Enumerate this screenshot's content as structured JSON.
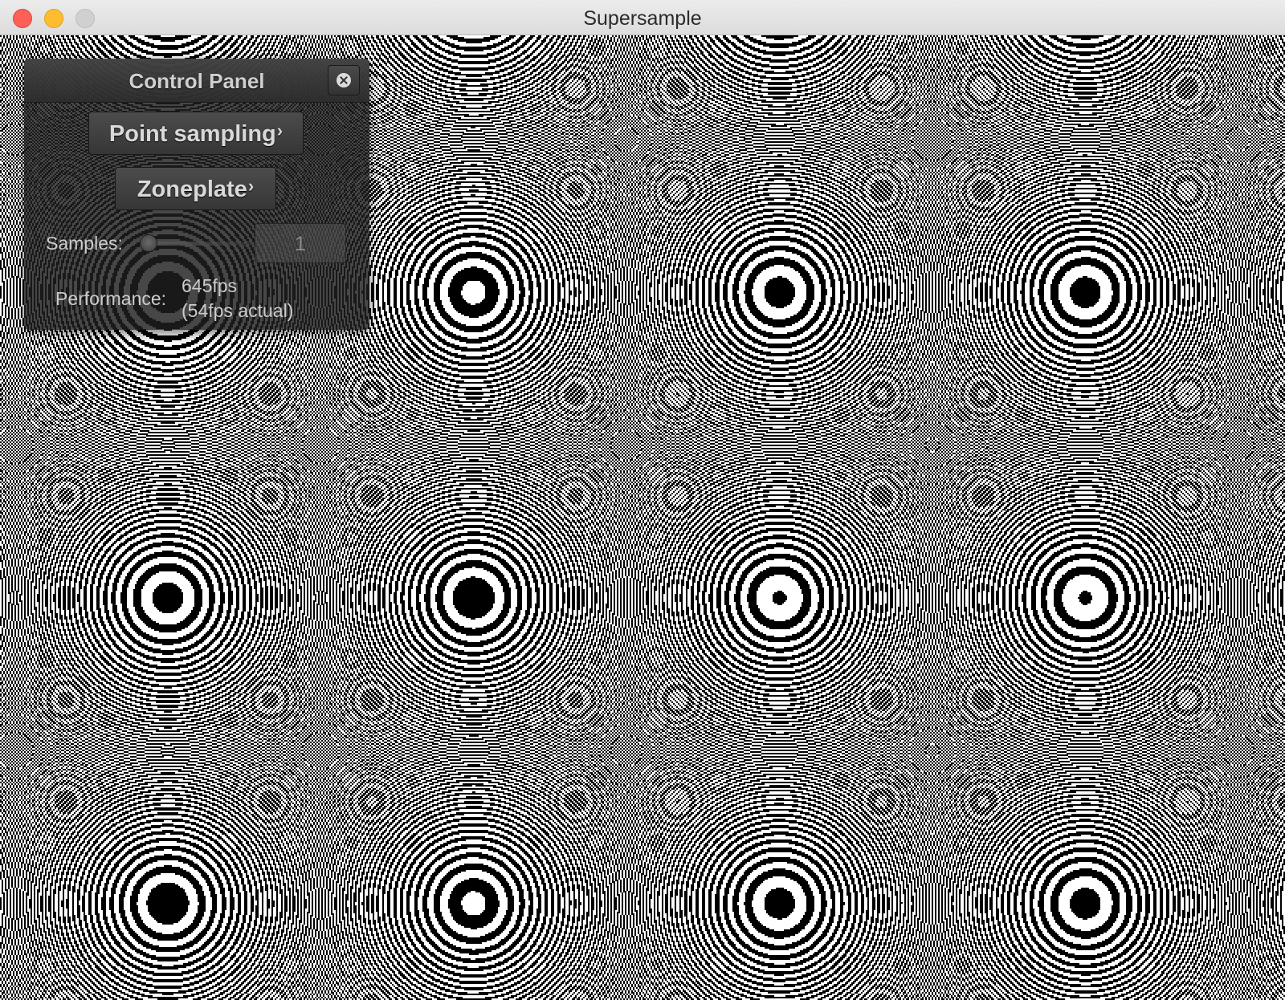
{
  "window": {
    "title": "Supersample"
  },
  "control_panel": {
    "title": "Control Panel",
    "sampling_button_label": "Point sampling",
    "pattern_button_label": "Zoneplate",
    "chevron": "›",
    "samples_label": "Samples:",
    "samples_slider_fraction": 0.0,
    "samples_value": "1",
    "performance_label": "Performance:",
    "performance_value": "645fps",
    "performance_actual": "(54fps actual)"
  },
  "icons": {
    "close": "close-icon",
    "traffic_lights": [
      "close",
      "minimize",
      "zoom"
    ]
  },
  "colors": {
    "traffic_close": "#fe5f57",
    "traffic_minimize": "#febc2e",
    "traffic_zoom": "#d0d0d0",
    "zoneplate_dark": "#000000",
    "zoneplate_light": "#ffffff"
  }
}
